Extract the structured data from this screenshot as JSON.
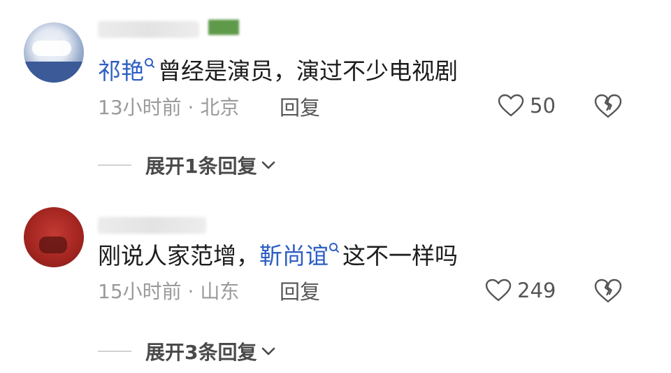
{
  "comments": [
    {
      "mention": "祁艳",
      "text": "曾经是演员，演过不少电视剧",
      "time": "13小时前",
      "location": "北京",
      "reply_label": "回复",
      "likes": "50",
      "expand_label": "展开1条回复"
    },
    {
      "prefix": "刚说人家范增，",
      "mention": "靳尚谊",
      "text": "这不一样吗",
      "time": "15小时前",
      "location": "山东",
      "reply_label": "回复",
      "likes": "249",
      "expand_label": "展开3条回复"
    }
  ],
  "separator": "·",
  "colors": {
    "mention": "#2d5fc3",
    "text": "#1c1c1c",
    "meta": "#9a9a9a",
    "action": "#555555"
  }
}
